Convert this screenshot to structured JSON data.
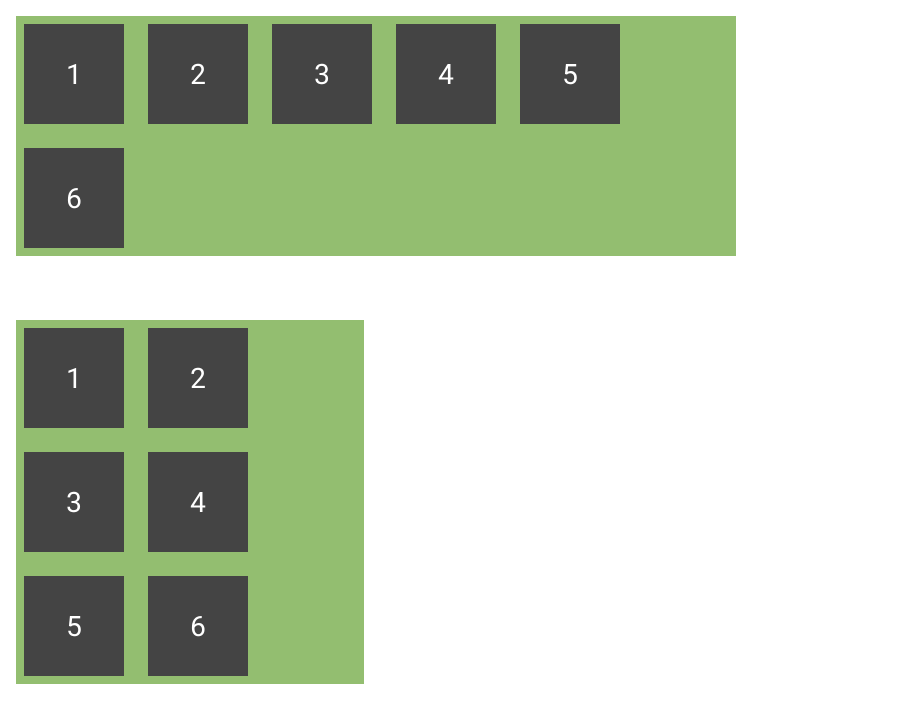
{
  "containers": {
    "wide": {
      "boxes": [
        "1",
        "2",
        "3",
        "4",
        "5",
        "6"
      ]
    },
    "narrow": {
      "boxes": [
        "1",
        "2",
        "3",
        "4",
        "5",
        "6"
      ]
    }
  },
  "colors": {
    "container_bg": "#93be70",
    "box_bg": "#444444",
    "box_text": "#ffffff"
  }
}
